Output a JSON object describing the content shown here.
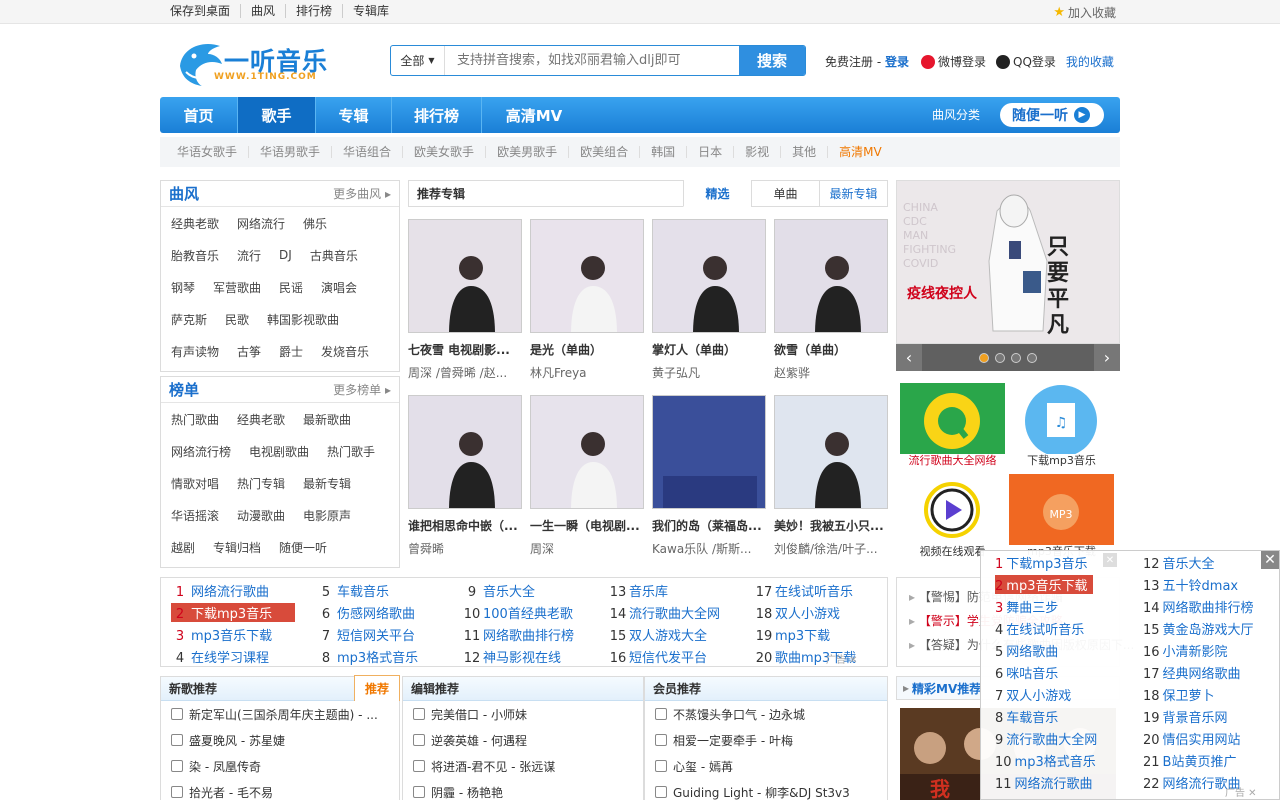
{
  "topbar": {
    "links": [
      "保存到桌面",
      "曲风",
      "排行榜",
      "专辑库"
    ],
    "fav": "加入收藏"
  },
  "logo": {
    "main": "一听音乐",
    "sub": "WWW.1TING.COM"
  },
  "search": {
    "category": "全部",
    "placeholder": "支持拼音搜索，如找邓丽君输入dlj即可",
    "button": "搜索"
  },
  "login": {
    "register": "免费注册",
    "sep": " - ",
    "login": "登录",
    "weibo": "微博登录",
    "qq": "QQ登录",
    "fav": "我的收藏"
  },
  "nav": {
    "items": [
      "首页",
      "歌手",
      "专辑",
      "排行榜",
      "高清MV"
    ],
    "genre": "曲风分类",
    "random": "随便一听"
  },
  "subnav": [
    "华语女歌手",
    "华语男歌手",
    "华语组合",
    "欧美女歌手",
    "欧美男歌手",
    "欧美组合",
    "韩国",
    "日本",
    "影视",
    "其他",
    "高清MV"
  ],
  "genres": {
    "title": "曲风",
    "more": "更多曲风",
    "rows": [
      [
        "经典老歌",
        "网络流行",
        "佛乐"
      ],
      [
        "胎教音乐",
        "流行",
        "DJ",
        "古典音乐"
      ],
      [
        "钢琴",
        "军营歌曲",
        "民谣",
        "演唱会"
      ],
      [
        "萨克斯",
        "民歌",
        "韩国影视歌曲"
      ],
      [
        "有声读物",
        "古筝",
        "爵士",
        "发烧音乐"
      ]
    ]
  },
  "charts": {
    "title": "榜单",
    "more": "更多榜单",
    "rows": [
      [
        "热门歌曲",
        "经典老歌",
        "最新歌曲"
      ],
      [
        "网络流行榜",
        "电视剧歌曲",
        "热门歌手"
      ],
      [
        "情歌对唱",
        "热门专辑",
        "最新专辑"
      ],
      [
        "华语摇滚",
        "动漫歌曲",
        "电影原声"
      ],
      [
        "越剧",
        "专辑归档",
        "随便一听"
      ]
    ]
  },
  "albums": {
    "title": "推荐专辑",
    "tabs": [
      "精选",
      "单曲",
      "最新专辑"
    ],
    "items": [
      {
        "name": "七夜雪 电视剧影...",
        "artist": "周深 /曾舜晞 /赵...",
        "bg": "#e6e1e8"
      },
      {
        "name": "是光（单曲）",
        "artist": "林凡Freya",
        "bg": "#e9e3ec"
      },
      {
        "name": "掌灯人（单曲）",
        "artist": "黄子弘凡",
        "bg": "#e4e0ea"
      },
      {
        "name": "欲雪（单曲）",
        "artist": "赵紫骅",
        "bg": "#e2dee8"
      },
      {
        "name": "谁把相思命中嵌（...",
        "artist": "曾舜晞",
        "bg": "#e3dfe9"
      },
      {
        "name": "一生一瞬（电视剧...",
        "artist": "周深",
        "bg": "#e7e3ec"
      },
      {
        "name": "我们的岛（莱福岛...",
        "artist": "Kawa乐队 /斯斯...",
        "bg": "#3a4f9a"
      },
      {
        "name": "美妙！我被五小只...",
        "artist": "刘俊麟/徐浩/叶子...",
        "bg": "#dfe5ef"
      }
    ]
  },
  "banner": {
    "title": "只要平凡",
    "sub": "疫线夜控人"
  },
  "tiles": [
    "流行歌曲大全网络",
    "下载mp3音乐",
    "视频在线观看",
    "mp3音乐下载"
  ],
  "links": [
    [
      "1",
      "网络流行歌曲"
    ],
    [
      "2",
      "下载mp3音乐"
    ],
    [
      "3",
      "mp3音乐下载"
    ],
    [
      "4",
      "在线学习课程"
    ],
    [
      "5",
      "车载音乐"
    ],
    [
      "6",
      "伤感网络歌曲"
    ],
    [
      "7",
      "短信网关平台"
    ],
    [
      "8",
      "mp3格式音乐"
    ],
    [
      "9",
      "音乐大全"
    ],
    [
      "10",
      "100首经典老歌"
    ],
    [
      "11",
      "网络歌曲排行榜"
    ],
    [
      "12",
      "神马影视在线"
    ],
    [
      "13",
      "音乐库"
    ],
    [
      "14",
      "流行歌曲大全网"
    ],
    [
      "15",
      "双人游戏大全"
    ],
    [
      "16",
      "短信代发平台"
    ],
    [
      "17",
      "在线试听音乐"
    ],
    [
      "18",
      "双人小游戏"
    ],
    [
      "19",
      "mp3下载"
    ],
    [
      "20",
      "歌曲mp3下载"
    ]
  ],
  "notice": [
    "【警惕】防范电信网络诈骗",
    "【警示】学生党防骗全攻略",
    "【答疑】为什么有些歌曲因版权原因下..."
  ],
  "newsongs": {
    "title": "新歌推荐",
    "badge": "推荐",
    "items": [
      "新定军山(三国杀周年庆主题曲) - ...",
      "盛夏晚风 - 苏星婕",
      "染 - 凤凰传奇",
      "拾光者 - 毛不易"
    ]
  },
  "editor": {
    "title": "编辑推荐",
    "items": [
      "完美借口 - 小师妹",
      "逆袭英雄 - 何遇程",
      "将进酒-君不见 - 张远谋",
      "阴霾 - 杨艳艳"
    ]
  },
  "member": {
    "title": "会员推荐",
    "items": [
      "不蒸馒头争口气 - 边永城",
      "相爱一定要牵手 - 叶梅",
      "心玺 - 嫣苒",
      "Guiding Light - 柳李&DJ St3v3"
    ]
  },
  "mv": {
    "title": "精彩MV推荐"
  },
  "popup": {
    "left": [
      [
        "1",
        "下载mp3音乐"
      ],
      [
        "2",
        "mp3音乐下载"
      ],
      [
        "3",
        "舞曲三步"
      ],
      [
        "4",
        "在线试听音乐"
      ],
      [
        "5",
        "网络歌曲"
      ],
      [
        "6",
        "咪咕音乐"
      ],
      [
        "7",
        "双人小游戏"
      ],
      [
        "8",
        "车载音乐"
      ],
      [
        "9",
        "流行歌曲大全网"
      ],
      [
        "10",
        "mp3格式音乐"
      ],
      [
        "11",
        "网络流行歌曲"
      ]
    ],
    "right": [
      [
        "12",
        "音乐大全"
      ],
      [
        "13",
        "五十铃dmax"
      ],
      [
        "14",
        "网络歌曲排行榜"
      ],
      [
        "15",
        "黄金岛游戏大厅"
      ],
      [
        "16",
        "小清新影院"
      ],
      [
        "17",
        "经典网络歌曲"
      ],
      [
        "18",
        "保卫萝卜"
      ],
      [
        "19",
        "背景音乐网"
      ],
      [
        "20",
        "情侣实用网站"
      ],
      [
        "21",
        "B站黄页推广"
      ],
      [
        "22",
        "网络流行歌曲"
      ]
    ]
  }
}
